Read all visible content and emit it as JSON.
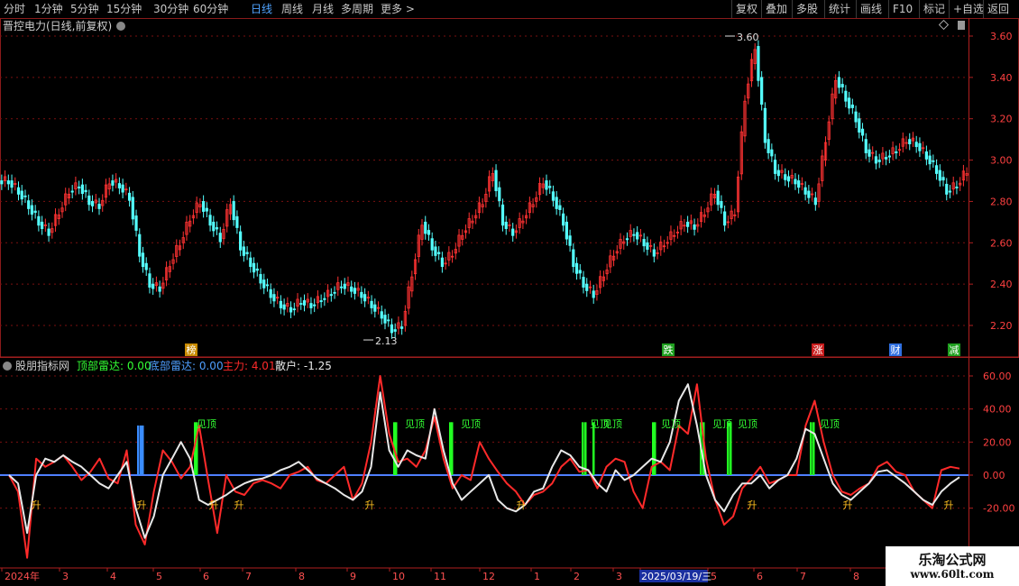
{
  "toolbar": {
    "periods": [
      "分时",
      "1分钟",
      "5分钟",
      "15分钟",
      "30分钟",
      "60分钟",
      "日线",
      "周线",
      "月线",
      "多周期",
      "更多 >"
    ],
    "active_period": "日线",
    "actions": [
      "复权",
      "叠加",
      "多股",
      "统计",
      "画线",
      "F10",
      "标记",
      "+自选",
      "返回"
    ]
  },
  "price_panel": {
    "title": "晋控电力(日线,前复权)",
    "y_labels": [
      "3.60",
      "3.40",
      "3.20",
      "3.00",
      "2.80",
      "2.60",
      "2.40",
      "2.20"
    ],
    "high_label": "3.60",
    "low_label": "2.13",
    "markers": [
      {
        "text": "榜",
        "bg": "#c88a00",
        "x": 212
      },
      {
        "text": "跌",
        "bg": "#1f9f1f",
        "x": 741
      },
      {
        "text": "涨",
        "bg": "#c81c1c",
        "x": 907
      },
      {
        "text": "财",
        "bg": "#2f6fe0",
        "x": 993
      },
      {
        "text": "减",
        "bg": "#1f9f1f",
        "x": 1058
      }
    ]
  },
  "indicator_panel": {
    "title": "股朋指标网",
    "legend": [
      {
        "label": "顶部雷达:",
        "value": "0.00",
        "color": "#33ff33"
      },
      {
        "label": "底部雷达:",
        "value": "0.00",
        "color": "#4f9fff"
      },
      {
        "label": "主力:",
        "value": "4.01",
        "color": "#ff2a2a"
      },
      {
        "label": "散户:",
        "value": "-1.25",
        "color": "#e8e8e8"
      }
    ],
    "y_labels": [
      "60.00",
      "40.00",
      "20.00",
      "0.00",
      "-20.00"
    ],
    "top_label": "见顶",
    "bottom_label": "升"
  },
  "timeline": {
    "labels": [
      "2024年",
      "3",
      "4",
      "5",
      "6",
      "7",
      "8",
      "9",
      "10",
      "11",
      "12",
      "1",
      "2",
      "3",
      "2025/03/19/三",
      "5",
      "6",
      "7",
      "8"
    ],
    "highlight": "2025/03/19/三"
  },
  "watermark": {
    "line1": "乐淘公式网",
    "line2": "www.60lt.com"
  },
  "colors": {
    "up": "#ff3232",
    "down": "#54ffff",
    "grid": "#7a1010",
    "axis": "#b02020",
    "zero_line": "#4f7fff"
  },
  "chart_data": [
    {
      "type": "candlestick",
      "title": "晋控电力(日线,前复权)",
      "ylim": [
        2.1,
        3.7
      ],
      "x_start": "2024-01",
      "x_end": "2025-09",
      "period": "daily",
      "max_point": 3.6,
      "min_point": 2.13,
      "close_series_approx": [
        2.9,
        2.85,
        2.78,
        2.7,
        2.65,
        2.75,
        2.85,
        2.88,
        2.8,
        2.78,
        2.9,
        2.88,
        2.82,
        2.55,
        2.4,
        2.38,
        2.5,
        2.6,
        2.72,
        2.8,
        2.7,
        2.62,
        2.8,
        2.58,
        2.5,
        2.42,
        2.35,
        2.3,
        2.28,
        2.32,
        2.3,
        2.33,
        2.36,
        2.4,
        2.38,
        2.35,
        2.3,
        2.25,
        2.18,
        2.2,
        2.45,
        2.7,
        2.58,
        2.5,
        2.55,
        2.65,
        2.72,
        2.8,
        2.95,
        2.7,
        2.65,
        2.72,
        2.8,
        2.9,
        2.82,
        2.7,
        2.5,
        2.4,
        2.35,
        2.45,
        2.55,
        2.62,
        2.65,
        2.6,
        2.55,
        2.6,
        2.65,
        2.7,
        2.68,
        2.75,
        2.85,
        2.7,
        2.75,
        3.3,
        3.55,
        3.1,
        2.95,
        2.92,
        2.9,
        2.85,
        2.8,
        3.1,
        3.4,
        3.3,
        3.2,
        3.05,
        3.0,
        3.02,
        3.05,
        3.1,
        3.08,
        3.02,
        2.95,
        2.85,
        2.88,
        2.95
      ]
    },
    {
      "type": "line",
      "title": "股朋指标网",
      "ylim": [
        -30,
        65
      ],
      "series": [
        {
          "name": "主力",
          "color": "#ff2a2a",
          "values": [
            0,
            -10,
            -50,
            10,
            5,
            8,
            12,
            5,
            -3,
            2,
            10,
            -2,
            -5,
            15,
            -30,
            -42,
            -10,
            15,
            8,
            -2,
            5,
            30,
            -3,
            -35,
            0,
            -10,
            -12,
            -5,
            -3,
            -5,
            -8,
            0,
            2,
            5,
            -3,
            -5,
            0,
            5,
            -15,
            -5,
            20,
            60,
            25,
            8,
            10,
            5,
            15,
            35,
            10,
            -8,
            0,
            -3,
            20,
            10,
            2,
            -5,
            -10,
            -18,
            -12,
            -10,
            -5,
            5,
            10,
            2,
            3,
            -8,
            5,
            10,
            8,
            -10,
            -20,
            5,
            8,
            3,
            30,
            25,
            55,
            10,
            -15,
            -30,
            -25,
            -8,
            -2,
            5,
            -5,
            -3,
            0,
            0,
            30,
            45,
            20,
            0,
            -10,
            -12,
            -8,
            -5,
            5,
            8,
            2,
            0,
            -10,
            -15,
            -20,
            3,
            5,
            4
          ]
        },
        {
          "name": "散户",
          "color": "#e8e8e8",
          "values": [
            0,
            -5,
            -35,
            0,
            10,
            8,
            12,
            8,
            5,
            0,
            -5,
            -8,
            0,
            8,
            -20,
            -38,
            -25,
            0,
            10,
            20,
            10,
            -15,
            -18,
            -15,
            -12,
            -8,
            -5,
            -3,
            -2,
            0,
            3,
            5,
            8,
            3,
            -2,
            -5,
            -8,
            -12,
            -15,
            -10,
            5,
            50,
            15,
            5,
            15,
            12,
            10,
            40,
            15,
            -5,
            -15,
            -10,
            -5,
            0,
            -15,
            -20,
            -22,
            -18,
            -10,
            -8,
            5,
            15,
            12,
            5,
            3,
            -5,
            -10,
            3,
            -3,
            0,
            5,
            10,
            8,
            20,
            45,
            55,
            30,
            0,
            -15,
            -22,
            -12,
            -5,
            -5,
            0,
            -8,
            -3,
            0,
            10,
            28,
            25,
            10,
            -5,
            -12,
            -15,
            -10,
            -5,
            2,
            3,
            -1,
            -5,
            -10,
            -15,
            -18,
            -10,
            -5,
            -1.25
          ]
        }
      ]
    }
  ]
}
